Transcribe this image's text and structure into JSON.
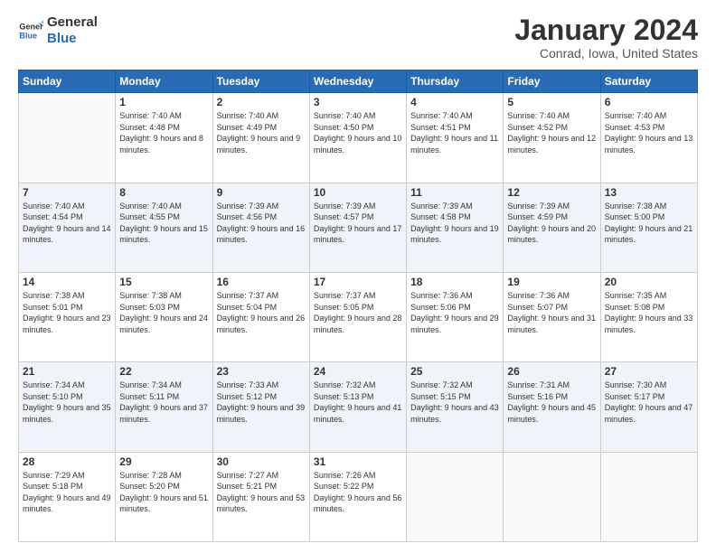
{
  "logo": {
    "text_general": "General",
    "text_blue": "Blue"
  },
  "header": {
    "month": "January 2024",
    "location": "Conrad, Iowa, United States"
  },
  "weekdays": [
    "Sunday",
    "Monday",
    "Tuesday",
    "Wednesday",
    "Thursday",
    "Friday",
    "Saturday"
  ],
  "weeks": [
    [
      {
        "day": "",
        "empty": true
      },
      {
        "day": "1",
        "sunrise": "7:40 AM",
        "sunset": "4:48 PM",
        "daylight": "9 hours and 8 minutes."
      },
      {
        "day": "2",
        "sunrise": "7:40 AM",
        "sunset": "4:49 PM",
        "daylight": "9 hours and 9 minutes."
      },
      {
        "day": "3",
        "sunrise": "7:40 AM",
        "sunset": "4:50 PM",
        "daylight": "9 hours and 10 minutes."
      },
      {
        "day": "4",
        "sunrise": "7:40 AM",
        "sunset": "4:51 PM",
        "daylight": "9 hours and 11 minutes."
      },
      {
        "day": "5",
        "sunrise": "7:40 AM",
        "sunset": "4:52 PM",
        "daylight": "9 hours and 12 minutes."
      },
      {
        "day": "6",
        "sunrise": "7:40 AM",
        "sunset": "4:53 PM",
        "daylight": "9 hours and 13 minutes."
      }
    ],
    [
      {
        "day": "7",
        "sunrise": "7:40 AM",
        "sunset": "4:54 PM",
        "daylight": "9 hours and 14 minutes."
      },
      {
        "day": "8",
        "sunrise": "7:40 AM",
        "sunset": "4:55 PM",
        "daylight": "9 hours and 15 minutes."
      },
      {
        "day": "9",
        "sunrise": "7:39 AM",
        "sunset": "4:56 PM",
        "daylight": "9 hours and 16 minutes."
      },
      {
        "day": "10",
        "sunrise": "7:39 AM",
        "sunset": "4:57 PM",
        "daylight": "9 hours and 17 minutes."
      },
      {
        "day": "11",
        "sunrise": "7:39 AM",
        "sunset": "4:58 PM",
        "daylight": "9 hours and 19 minutes."
      },
      {
        "day": "12",
        "sunrise": "7:39 AM",
        "sunset": "4:59 PM",
        "daylight": "9 hours and 20 minutes."
      },
      {
        "day": "13",
        "sunrise": "7:38 AM",
        "sunset": "5:00 PM",
        "daylight": "9 hours and 21 minutes."
      }
    ],
    [
      {
        "day": "14",
        "sunrise": "7:38 AM",
        "sunset": "5:01 PM",
        "daylight": "9 hours and 23 minutes."
      },
      {
        "day": "15",
        "sunrise": "7:38 AM",
        "sunset": "5:03 PM",
        "daylight": "9 hours and 24 minutes."
      },
      {
        "day": "16",
        "sunrise": "7:37 AM",
        "sunset": "5:04 PM",
        "daylight": "9 hours and 26 minutes."
      },
      {
        "day": "17",
        "sunrise": "7:37 AM",
        "sunset": "5:05 PM",
        "daylight": "9 hours and 28 minutes."
      },
      {
        "day": "18",
        "sunrise": "7:36 AM",
        "sunset": "5:06 PM",
        "daylight": "9 hours and 29 minutes."
      },
      {
        "day": "19",
        "sunrise": "7:36 AM",
        "sunset": "5:07 PM",
        "daylight": "9 hours and 31 minutes."
      },
      {
        "day": "20",
        "sunrise": "7:35 AM",
        "sunset": "5:08 PM",
        "daylight": "9 hours and 33 minutes."
      }
    ],
    [
      {
        "day": "21",
        "sunrise": "7:34 AM",
        "sunset": "5:10 PM",
        "daylight": "9 hours and 35 minutes."
      },
      {
        "day": "22",
        "sunrise": "7:34 AM",
        "sunset": "5:11 PM",
        "daylight": "9 hours and 37 minutes."
      },
      {
        "day": "23",
        "sunrise": "7:33 AM",
        "sunset": "5:12 PM",
        "daylight": "9 hours and 39 minutes."
      },
      {
        "day": "24",
        "sunrise": "7:32 AM",
        "sunset": "5:13 PM",
        "daylight": "9 hours and 41 minutes."
      },
      {
        "day": "25",
        "sunrise": "7:32 AM",
        "sunset": "5:15 PM",
        "daylight": "9 hours and 43 minutes."
      },
      {
        "day": "26",
        "sunrise": "7:31 AM",
        "sunset": "5:16 PM",
        "daylight": "9 hours and 45 minutes."
      },
      {
        "day": "27",
        "sunrise": "7:30 AM",
        "sunset": "5:17 PM",
        "daylight": "9 hours and 47 minutes."
      }
    ],
    [
      {
        "day": "28",
        "sunrise": "7:29 AM",
        "sunset": "5:18 PM",
        "daylight": "9 hours and 49 minutes."
      },
      {
        "day": "29",
        "sunrise": "7:28 AM",
        "sunset": "5:20 PM",
        "daylight": "9 hours and 51 minutes."
      },
      {
        "day": "30",
        "sunrise": "7:27 AM",
        "sunset": "5:21 PM",
        "daylight": "9 hours and 53 minutes."
      },
      {
        "day": "31",
        "sunrise": "7:26 AM",
        "sunset": "5:22 PM",
        "daylight": "9 hours and 56 minutes."
      },
      {
        "day": "",
        "empty": true
      },
      {
        "day": "",
        "empty": true
      },
      {
        "day": "",
        "empty": true
      }
    ]
  ]
}
